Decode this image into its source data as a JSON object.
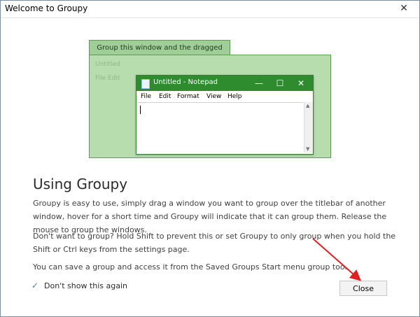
{
  "window": {
    "title": "Welcome to Groupy",
    "close_glyph": "✕"
  },
  "illustration": {
    "group_tab_label": "Group this window and the dragged window",
    "ghost_title": "Untitled",
    "ghost_menu": "File   Edit",
    "notepad": {
      "title": "Untitled - Notepad",
      "menu": [
        "File",
        "Edit",
        "Format",
        "View",
        "Help"
      ],
      "min_glyph": "—",
      "max_glyph": "☐",
      "close_glyph": "✕"
    }
  },
  "content": {
    "heading": "Using Groupy",
    "paragraphs": [
      "Groupy is easy to use, simply drag a window you want to group over the titlebar of another window, hover for a short time and Groupy will indicate that it can group them.  Release the mouse to group the windows.",
      "Don't want to group?  Hold Shift to prevent this or set Groupy to only group when you hold the Shift or Ctrl keys from the settings page.",
      "You can save a group and access it from the Saved Groups Start menu group too."
    ]
  },
  "footer": {
    "dont_show_label": "Don't show this again",
    "check_glyph": "✓",
    "close_label": "Close"
  },
  "colors": {
    "accent_green": "#2e8b2e",
    "annotation_red": "#e02020"
  }
}
